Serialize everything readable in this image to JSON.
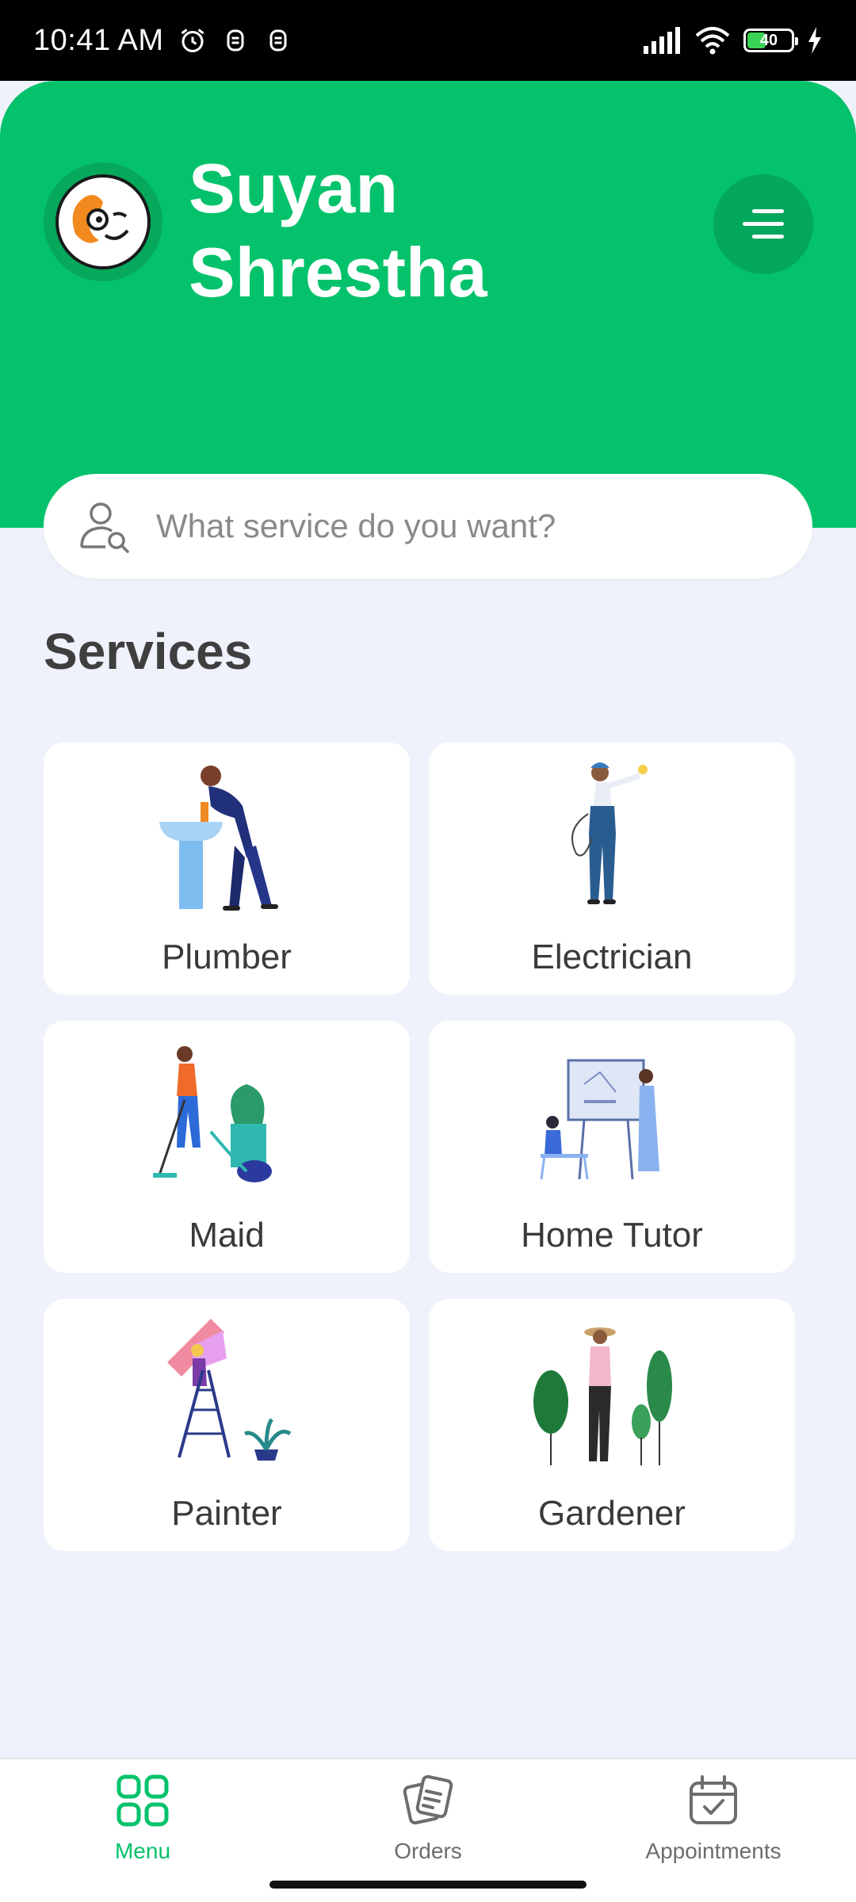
{
  "status_bar": {
    "time": "10:41 AM",
    "battery": "40"
  },
  "header": {
    "user_name": "Suyan Shrestha"
  },
  "search": {
    "placeholder": "What service do you want?"
  },
  "services": {
    "title": "Services",
    "items": [
      {
        "label": "Plumber",
        "icon": "plumber-illustration"
      },
      {
        "label": "Electrician",
        "icon": "electrician-illustration"
      },
      {
        "label": "Maid",
        "icon": "maid-illustration"
      },
      {
        "label": "Home Tutor",
        "icon": "home-tutor-illustration"
      },
      {
        "label": "Painter",
        "icon": "painter-illustration"
      },
      {
        "label": "Gardener",
        "icon": "gardener-illustration"
      }
    ]
  },
  "bottom_nav": {
    "items": [
      {
        "label": "Menu",
        "icon": "grid-icon",
        "active": true
      },
      {
        "label": "Orders",
        "icon": "orders-icon",
        "active": false
      },
      {
        "label": "Appointments",
        "icon": "calendar-check-icon",
        "active": false
      }
    ]
  },
  "colors": {
    "brand": "#04c26b",
    "background": "#eff2fb",
    "battery_fill": "#39d353"
  }
}
